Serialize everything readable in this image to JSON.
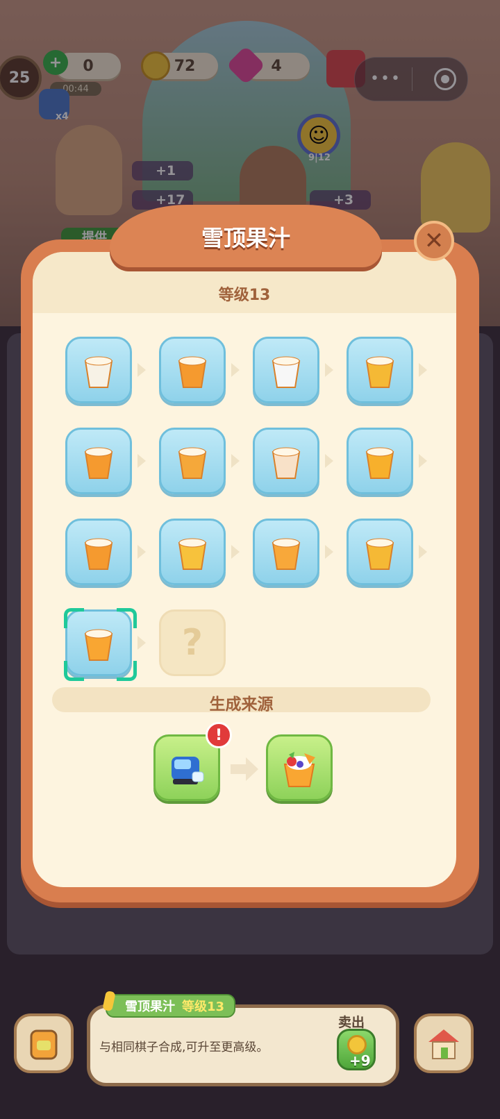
{
  "hud": {
    "level": "25",
    "energy": "0",
    "energy_timer": "00:44",
    "coins": "72",
    "gems": "4",
    "boost_multiplier": "x4",
    "happy_progress": "9|12"
  },
  "customers": [
    {
      "reward1": "+1",
      "reward2": "+17",
      "button_label": "提供"
    },
    {
      "reward1": "+3"
    }
  ],
  "modal": {
    "title": "雪顶果汁",
    "level_label": "等级13",
    "chain_items": [
      {
        "name": "empty-cup"
      },
      {
        "name": "tea-cup"
      },
      {
        "name": "yogurt-box"
      },
      {
        "name": "honey-jar"
      },
      {
        "name": "juice-can"
      },
      {
        "name": "bubble-tea"
      },
      {
        "name": "foam-juice-mug"
      },
      {
        "name": "orange-juice-glass"
      },
      {
        "name": "tropical-juice-jar"
      },
      {
        "name": "fruit-tea-pot"
      },
      {
        "name": "orange-cocktail"
      },
      {
        "name": "fruit-juice-bowl"
      },
      {
        "name": "snow-top-juice",
        "selected": true
      },
      {
        "name": "unknown-item",
        "label": "?"
      }
    ],
    "source_title": "生成来源",
    "source_generator": "ice-machine",
    "source_result": "snow-top-juice",
    "alert": "!"
  },
  "bottom": {
    "item_name": "雪顶果汁",
    "item_level": "等级13",
    "description": "与相同棋子合成,可升至更高级。",
    "sell_label": "卖出",
    "sell_amount": "+9"
  },
  "colors": {
    "modal_frame": "#d97e4f",
    "modal_panel": "#fdf4df",
    "tile_blue": "#8fd2ea",
    "tile_green": "#8ed25a",
    "selection": "#1fc99a"
  }
}
